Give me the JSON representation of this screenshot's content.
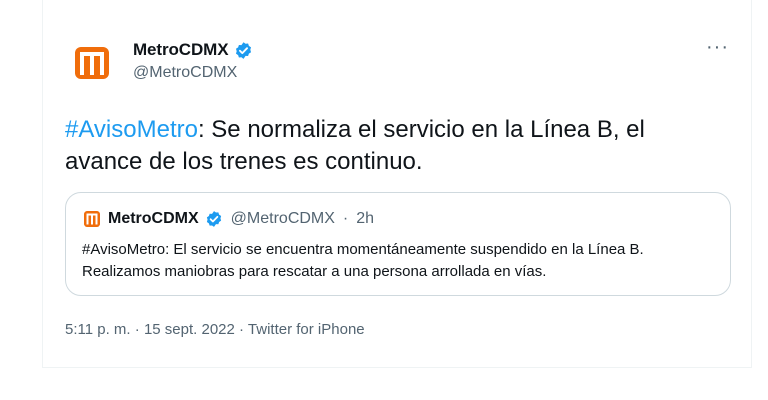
{
  "author": {
    "name": "MetroCDMX",
    "handle": "@MetroCDMX",
    "verified": true,
    "avatar_icon": "metro-logo-icon",
    "brand_color": "#f06d0b"
  },
  "menu": {
    "more_label": "···"
  },
  "tweet": {
    "hashtag": "#AvisoMetro",
    "body": ": Se normaliza el servicio en la Línea B, el avance de los trenes es continuo."
  },
  "quoted_tweet": {
    "name": "MetroCDMX",
    "handle": "@MetroCDMX",
    "separator": "·",
    "time": "2h",
    "text": "#AvisoMetro: El servicio se encuentra momentáneamente suspendido en la Línea B. Realizamos maniobras para rescatar a una persona arrollada en vías."
  },
  "meta": {
    "time": "5:11 p. m.",
    "date": "15 sept. 2022",
    "source": "Twitter for iPhone",
    "separator": " · "
  },
  "colors": {
    "link": "#1d9bf0",
    "verified": "#1d9bf0",
    "secondary_text": "#536471",
    "border": "#cfd9de"
  }
}
